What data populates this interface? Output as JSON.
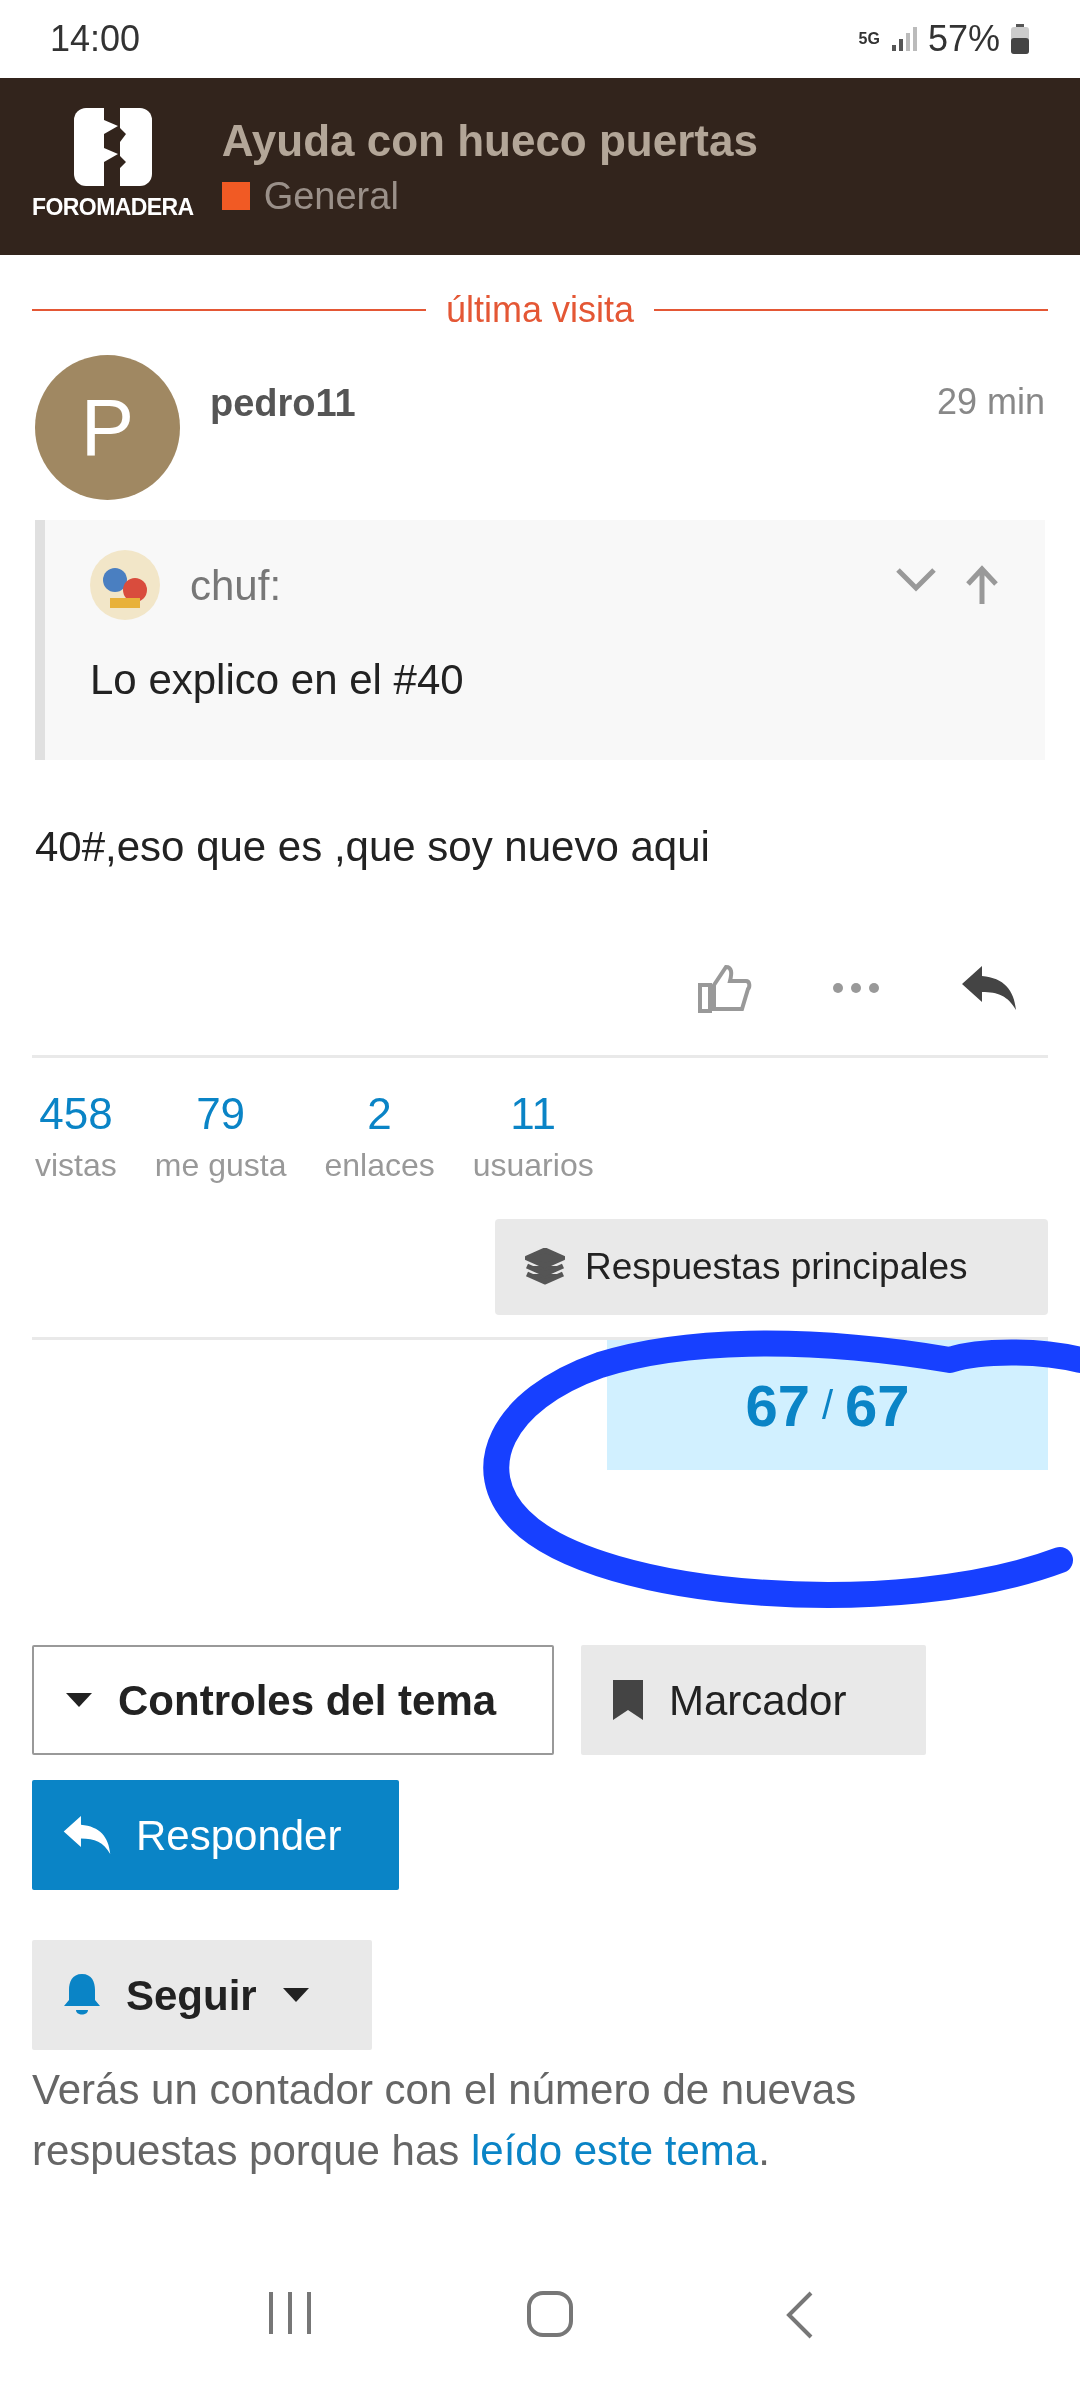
{
  "status_bar": {
    "time": "14:00",
    "network": "5G",
    "battery": "57%"
  },
  "header": {
    "logo_text": "FOROMADERA",
    "title": "Ayuda con hueco puertas",
    "category": {
      "name": "General",
      "color": "#f15a24"
    }
  },
  "divider_label": "última visita",
  "post": {
    "avatar_letter": "P",
    "author": "pedro11",
    "time": "29 min",
    "quote": {
      "author": "chuf:",
      "text": "Lo explico en el #40"
    },
    "body": "40#,eso que es ,que soy nuevo aqui"
  },
  "stats": [
    {
      "value": "458",
      "label": "vistas"
    },
    {
      "value": "79",
      "label": "me gusta"
    },
    {
      "value": "2",
      "label": "enlaces"
    },
    {
      "value": "11",
      "label": "usuarios"
    }
  ],
  "top_replies_button": "Respuestas principales",
  "progress": {
    "current": "67",
    "separator": "/",
    "total": "67"
  },
  "buttons": [
    {
      "kind": "dropdown",
      "label": "Controles del tema"
    },
    {
      "kind": "bookmark",
      "label": "Marcador"
    },
    {
      "kind": "reply",
      "label": "Responder"
    },
    {
      "kind": "notify",
      "label": "Seguir"
    }
  ],
  "footer_text": {
    "before": "Verás un contador con el número de nuevas respuestas porque has ",
    "link": "leído este tema",
    "after": "."
  }
}
